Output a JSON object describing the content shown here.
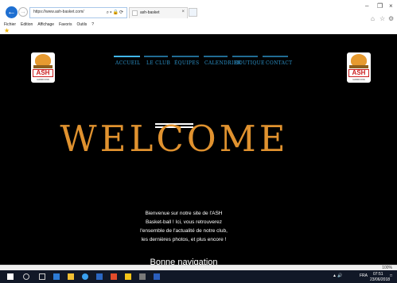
{
  "browser": {
    "url": "https://www.ash-basket.com/",
    "tab_title": "ash-basket",
    "menu": [
      "Fichier",
      "Edition",
      "Affichage",
      "Favoris",
      "Outils",
      "?"
    ]
  },
  "site": {
    "nav": [
      "ACCUEIL",
      "LE CLUB",
      "ÉQUIPES",
      "CALENDRIER",
      "BOUTIQUE",
      "CONTACT"
    ],
    "welcome": "WELCOME",
    "intro": [
      "Bienvenue sur notre site de l'ASH",
      "Basket-ball ! Ici, vous retrouverez",
      "l'ensemble de l'actualité de notre club,",
      "les dernières photos, et plus encore !"
    ],
    "bonne": "Bonne navigation",
    "logo_text": "ASH",
    "logo_sub": "GRIFFONS",
    "colors": {
      "accent": "#e0922f",
      "nav": "#2c90c6",
      "background": "#000000"
    }
  },
  "status": {
    "zoom": "100%"
  },
  "taskbar": {
    "lang": "FRA",
    "time": "07:51",
    "date": "23/06/2018"
  }
}
